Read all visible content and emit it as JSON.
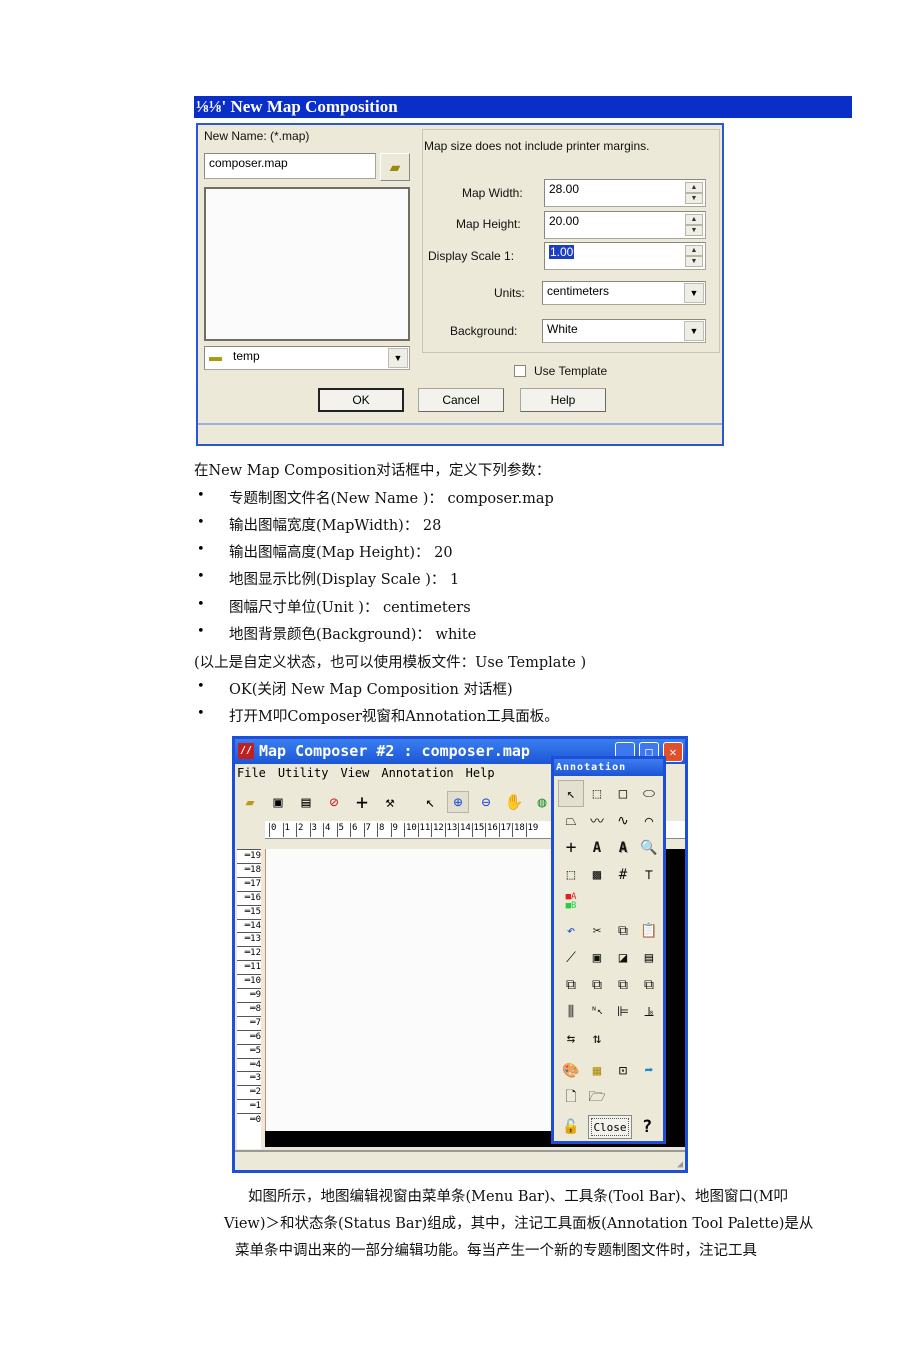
{
  "heading": "⅛⅛' New Map Composition",
  "dialog": {
    "new_name_label": "New Name: (*.map)",
    "new_name_value": "composer.map",
    "folder_value": "temp",
    "note": "Map size does not include printer margins.",
    "map_width_label": "Map Width:",
    "map_width_value": "28.00",
    "map_height_label": "Map Height:",
    "map_height_value": "20.00",
    "display_scale_label": "Display Scale 1:",
    "display_scale_value": "1.00",
    "units_label": "Units:",
    "units_value": "centimeters",
    "background_label": "Background:",
    "background_value": "White",
    "use_template_label": "Use Template",
    "use_template_checked": false,
    "ok": "OK",
    "cancel": "Cancel",
    "help": "Help"
  },
  "intro": "在New Map Composition对话框中，定义下列参数：",
  "params": [
    "专题制图文件名(New Name )：  composer.map",
    "输出图幅宽度(MapWidth)：  28",
    "输出图幅高度(Map Height)：  20",
    "地图显示比例(Display Scale )：   1",
    "图幅尺寸单位(Unit )：   centimeters",
    "地图背景颜色(Background)：  white"
  ],
  "note_line": "(以上是自定义状态，也可以使用模板文件：Use Template )",
  "steps": [
    "OK(关闭  New Map Composition 对话框)",
    "打开M叩Composer视窗和Annotation工具面板。"
  ],
  "bullet": "•",
  "composer": {
    "title": "Map Composer #2 : composer.map",
    "menu": [
      "File",
      "Utility",
      "View",
      "Annotation",
      "Help"
    ],
    "toolbar_icons": [
      "open-icon",
      "save-icon",
      "print-icon",
      "clear-icon",
      "crosshair-icon",
      "hammer-icon",
      "select-arrow-icon",
      "zoom-in-icon",
      "zoom-out-icon",
      "pan-hand-icon",
      "globe-icon"
    ],
    "ruler_top": [
      "0",
      "1",
      "2",
      "3",
      "4",
      "5",
      "6",
      "7",
      "8",
      "9",
      "10",
      "11",
      "12",
      "13",
      "14",
      "15",
      "16",
      "17",
      "18",
      "19"
    ],
    "ruler_left": [
      "19",
      "18",
      "17",
      "16",
      "15",
      "14",
      "13",
      "12",
      "11",
      "10",
      "9",
      "8",
      "7",
      "6",
      "5",
      "4",
      "3",
      "2",
      "1",
      "0"
    ]
  },
  "annotation": {
    "title": "Annotation",
    "close": "Close",
    "help": "?"
  },
  "paragraph": [
    "如图所示，地图编辑视窗由菜单条(Menu Bar)、工具条(Tool Bar)、地图窗口(M叩",
    "View)＞和状态条(Status Bar)组成，其中，注记工具面板(Annotation Tool Palette)是从",
    "菜单条中调出来的一部分编辑功能。每当产生一个新的专题制图文件时，注记工具"
  ]
}
